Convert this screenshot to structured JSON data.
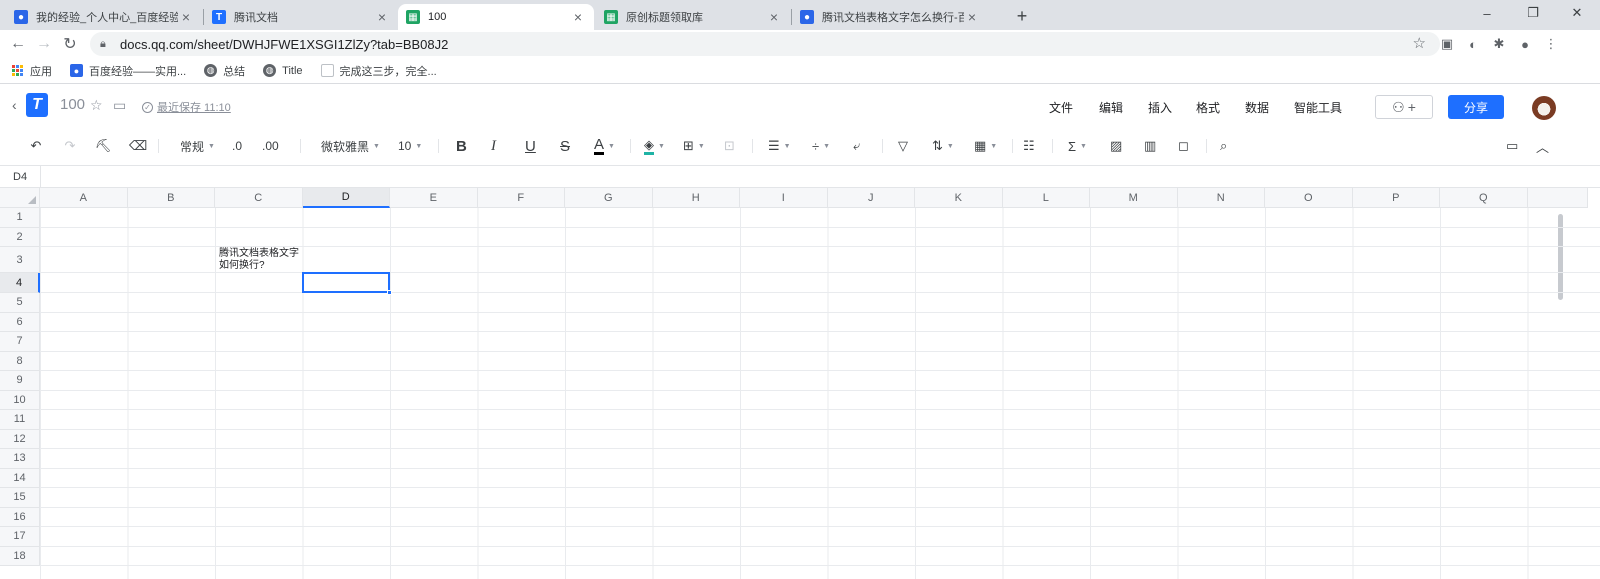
{
  "browser": {
    "tabs": [
      {
        "title": "我的经验_个人中心_百度经验",
        "icon": "baidu-paw-icon"
      },
      {
        "title": "腾讯文档",
        "icon": "tencent-docs-icon"
      },
      {
        "title": "100",
        "icon": "sheet-icon",
        "active": true
      },
      {
        "title": "原创标题领取库",
        "icon": "sheet-icon"
      },
      {
        "title": "腾讯文档表格文字怎么换行-百度",
        "icon": "baidu-paw-icon"
      }
    ],
    "new_tab": "+",
    "window_controls": {
      "minimize": "–",
      "restore": "❐",
      "close": "✕"
    },
    "url": "docs.qq.com/sheet/DWHJFWE1XSGI1ZlZy?tab=BB08J2",
    "bookmarks": [
      {
        "label": "应用",
        "icon": "apps-grid-icon"
      },
      {
        "label": "百度经验——实用...",
        "icon": "baidu-paw-icon"
      },
      {
        "label": "总结",
        "icon": "globe-icon"
      },
      {
        "label": "Title",
        "icon": "globe-icon"
      },
      {
        "label": "完成这三步，完全...",
        "icon": "page-icon"
      }
    ]
  },
  "doc": {
    "title": "100",
    "save_status": "最近保存 11:10",
    "menu": [
      "文件",
      "编辑",
      "插入",
      "格式",
      "数据",
      "智能工具"
    ],
    "share_label": "分享",
    "invite_label": "+"
  },
  "toolbar": {
    "number_format": "常规",
    "decimal_decrease": ".0",
    "decimal_increase": ".00",
    "font_family": "微软雅黑",
    "font_size": "10",
    "bold": "B",
    "italic": "I",
    "underline": "U",
    "strike": "S",
    "font_color": "A",
    "font_color_value": "#000000",
    "fill_color_value": "#1fb3a5"
  },
  "namebox": "D4",
  "sheet": {
    "columns": [
      "A",
      "B",
      "C",
      "D",
      "E",
      "F",
      "G",
      "H",
      "I",
      "J",
      "K",
      "L",
      "M",
      "N",
      "O",
      "P",
      "Q"
    ],
    "rows": [
      "1",
      "2",
      "3",
      "4",
      "5",
      "6",
      "7",
      "8",
      "9",
      "10",
      "11",
      "12",
      "13",
      "14",
      "15",
      "16",
      "17",
      "18"
    ],
    "selected_column": "D",
    "selected_row": "4",
    "cells": [
      {
        "ref": "C3",
        "lines": [
          "腾讯文档表格文字",
          "如何换行?"
        ]
      }
    ]
  }
}
